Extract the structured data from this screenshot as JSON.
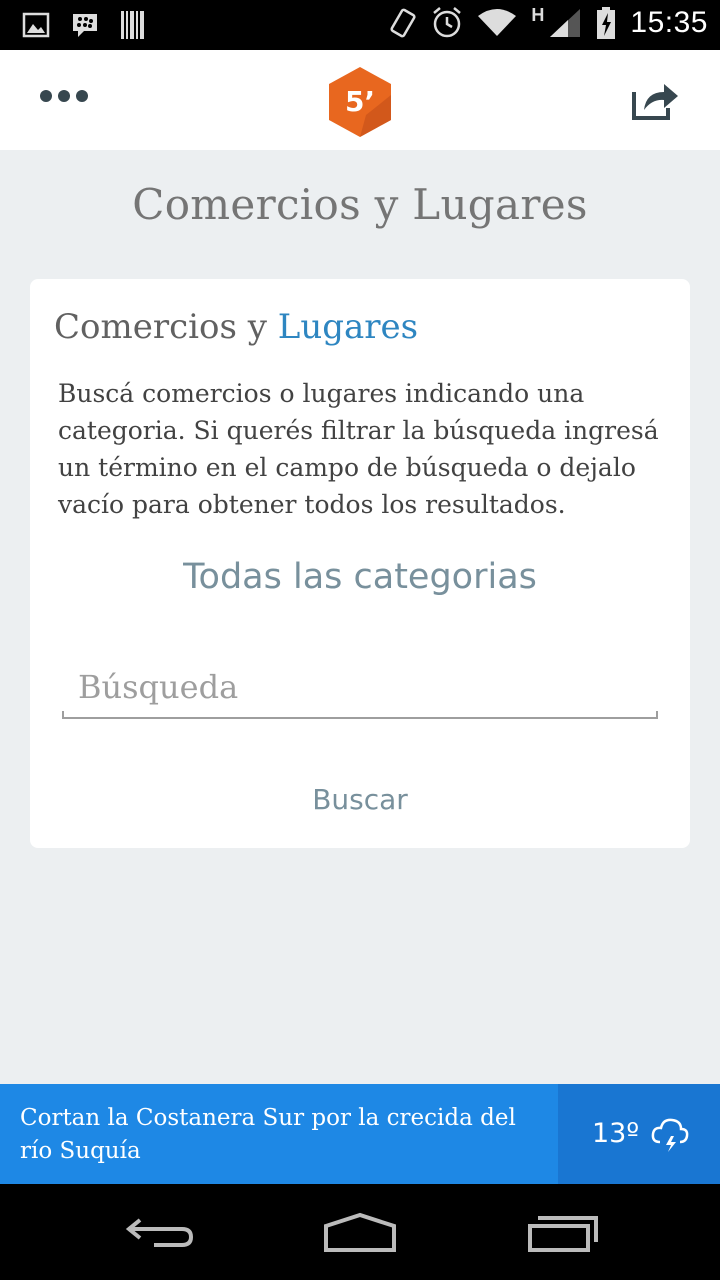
{
  "status_bar": {
    "time": "15:35",
    "network_type": "H",
    "left_icons": [
      "image-icon",
      "bbm-icon",
      "barcode-icon"
    ],
    "right_icons": [
      "vibrate-icon",
      "alarm-icon",
      "wifi-icon",
      "signal-icon",
      "battery-icon"
    ]
  },
  "app_bar": {
    "menu_icon": "more-dots-icon",
    "logo_text": "5’",
    "logo_color": "#e8671f",
    "share_icon": "share-icon"
  },
  "page": {
    "title": "Comercios y Lugares"
  },
  "card": {
    "heading_plain": "Comercios y ",
    "heading_accent": "Lugares",
    "accent_color": "#2e86c1",
    "description": "Buscá comercios o lugares indicando una categoria. Si querés filtrar la búsqueda ingresá un término en el campo de búsqueda o dejalo vacío para obtener todos los resultados.",
    "category_selected": "Todas las categorias",
    "search_placeholder": "Búsqueda",
    "search_value": "",
    "search_button": "Buscar"
  },
  "news_bar": {
    "headline": "Cortan la Costanera Sur por la crecida del río Suquía",
    "temperature": "13º",
    "weather_icon": "thunderstorm-icon",
    "background": "#1e88e5"
  },
  "nav_bar": {
    "icons": [
      "back-icon",
      "home-icon",
      "recents-icon"
    ]
  }
}
